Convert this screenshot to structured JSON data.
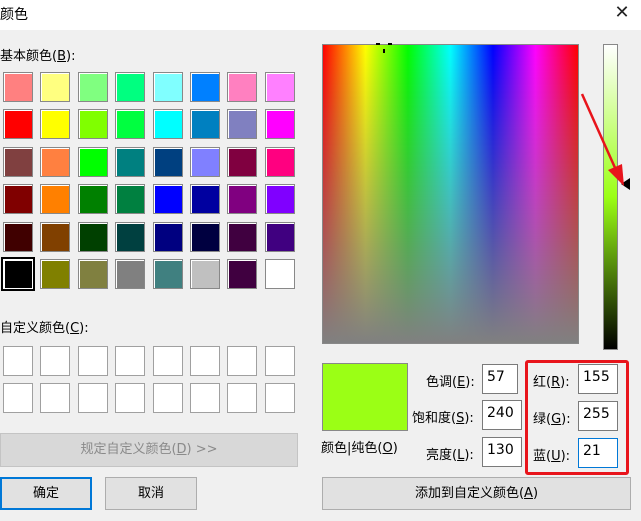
{
  "window": {
    "title": "颜色",
    "close_glyph": "✕"
  },
  "basic_colors": {
    "label": "基本颜色(B):",
    "label_parts": [
      "基本颜色(",
      "B",
      "):"
    ],
    "swatches": [
      "#ff8080",
      "#ffff80",
      "#80ff80",
      "#00ff80",
      "#80ffff",
      "#0080ff",
      "#ff80c0",
      "#ff80ff",
      "#ff0000",
      "#ffff00",
      "#80ff00",
      "#00ff40",
      "#00ffff",
      "#0080c0",
      "#8080c0",
      "#ff00ff",
      "#804040",
      "#ff8040",
      "#00ff00",
      "#008080",
      "#004080",
      "#8080ff",
      "#800040",
      "#ff0080",
      "#800000",
      "#ff8000",
      "#008000",
      "#008040",
      "#0000ff",
      "#0000a0",
      "#800080",
      "#8000ff",
      "#400000",
      "#804000",
      "#004000",
      "#004040",
      "#000080",
      "#000040",
      "#400040",
      "#400080",
      "#000000",
      "#808000",
      "#808040",
      "#808080",
      "#408080",
      "#c0c0c0",
      "#400040",
      "#ffffff"
    ],
    "selected_index": 40
  },
  "custom_colors": {
    "label_parts": [
      "自定义颜色(",
      "C",
      "):"
    ],
    "count": 16
  },
  "buttons": {
    "define_custom": "规定自定义颜色(D) >>",
    "define_custom_parts": [
      "规定自定义颜色(",
      "D",
      ") >>"
    ],
    "ok": "确定",
    "cancel": "取消",
    "add_custom_parts": [
      "添加到自定义颜色(",
      "A",
      ")"
    ]
  },
  "preview": {
    "label_parts": [
      "颜色|纯色(",
      "O",
      ")"
    ],
    "color": "#9bff15"
  },
  "hsl": {
    "hue": {
      "label_parts": [
        "色调(",
        "E",
        "):"
      ],
      "value": "57"
    },
    "sat": {
      "label_parts": [
        "饱和度(",
        "S",
        "):"
      ],
      "value": "240"
    },
    "lum": {
      "label_parts": [
        "亮度(",
        "L",
        "):"
      ],
      "value": "130"
    }
  },
  "rgb": {
    "red": {
      "label_parts": [
        "红(",
        "R",
        "):"
      ],
      "value": "155"
    },
    "green": {
      "label_parts": [
        "绿(",
        "G",
        "):"
      ],
      "value": "255"
    },
    "blue": {
      "label_parts": [
        "蓝(",
        "U",
        "):"
      ],
      "value": "21"
    }
  },
  "annotation": {
    "highlight_color": "#e8141b"
  }
}
